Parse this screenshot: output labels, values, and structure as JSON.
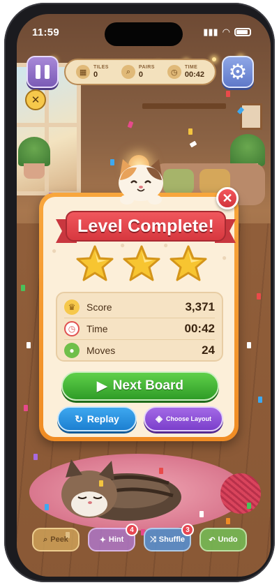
{
  "status_bar": {
    "time": "11:59"
  },
  "hud": {
    "stats": [
      {
        "label": "TILES",
        "value": "0",
        "icon": "tiles-icon"
      },
      {
        "label": "PAIRS",
        "value": "0",
        "icon": "magnifier-icon"
      },
      {
        "label": "TIME",
        "value": "00:42",
        "icon": "clock-icon"
      }
    ]
  },
  "modal": {
    "title": "Level Complete!",
    "stars_earned": 3,
    "stars_total": 3,
    "rows": [
      {
        "label": "Score",
        "value": "3,371",
        "icon": "trophy-icon"
      },
      {
        "label": "Time",
        "value": "00:42",
        "icon": "clock-icon"
      },
      {
        "label": "Moves",
        "value": "24",
        "icon": "paw-icon"
      }
    ],
    "next_label": "Next Board",
    "replay_label": "Replay",
    "layout_label": "Choose Layout"
  },
  "toolbar": {
    "peek_label": "Peek",
    "hint_label": "Hint",
    "hint_count": "4",
    "shuffle_label": "Shuffle",
    "shuffle_count": "3",
    "undo_label": "Undo"
  },
  "colors": {
    "ribbon": "#e0434a",
    "modal_border": "#f59a30",
    "next_button": "#3fae33",
    "replay_button": "#2a92e0",
    "layout_button": "#8f50d8"
  }
}
